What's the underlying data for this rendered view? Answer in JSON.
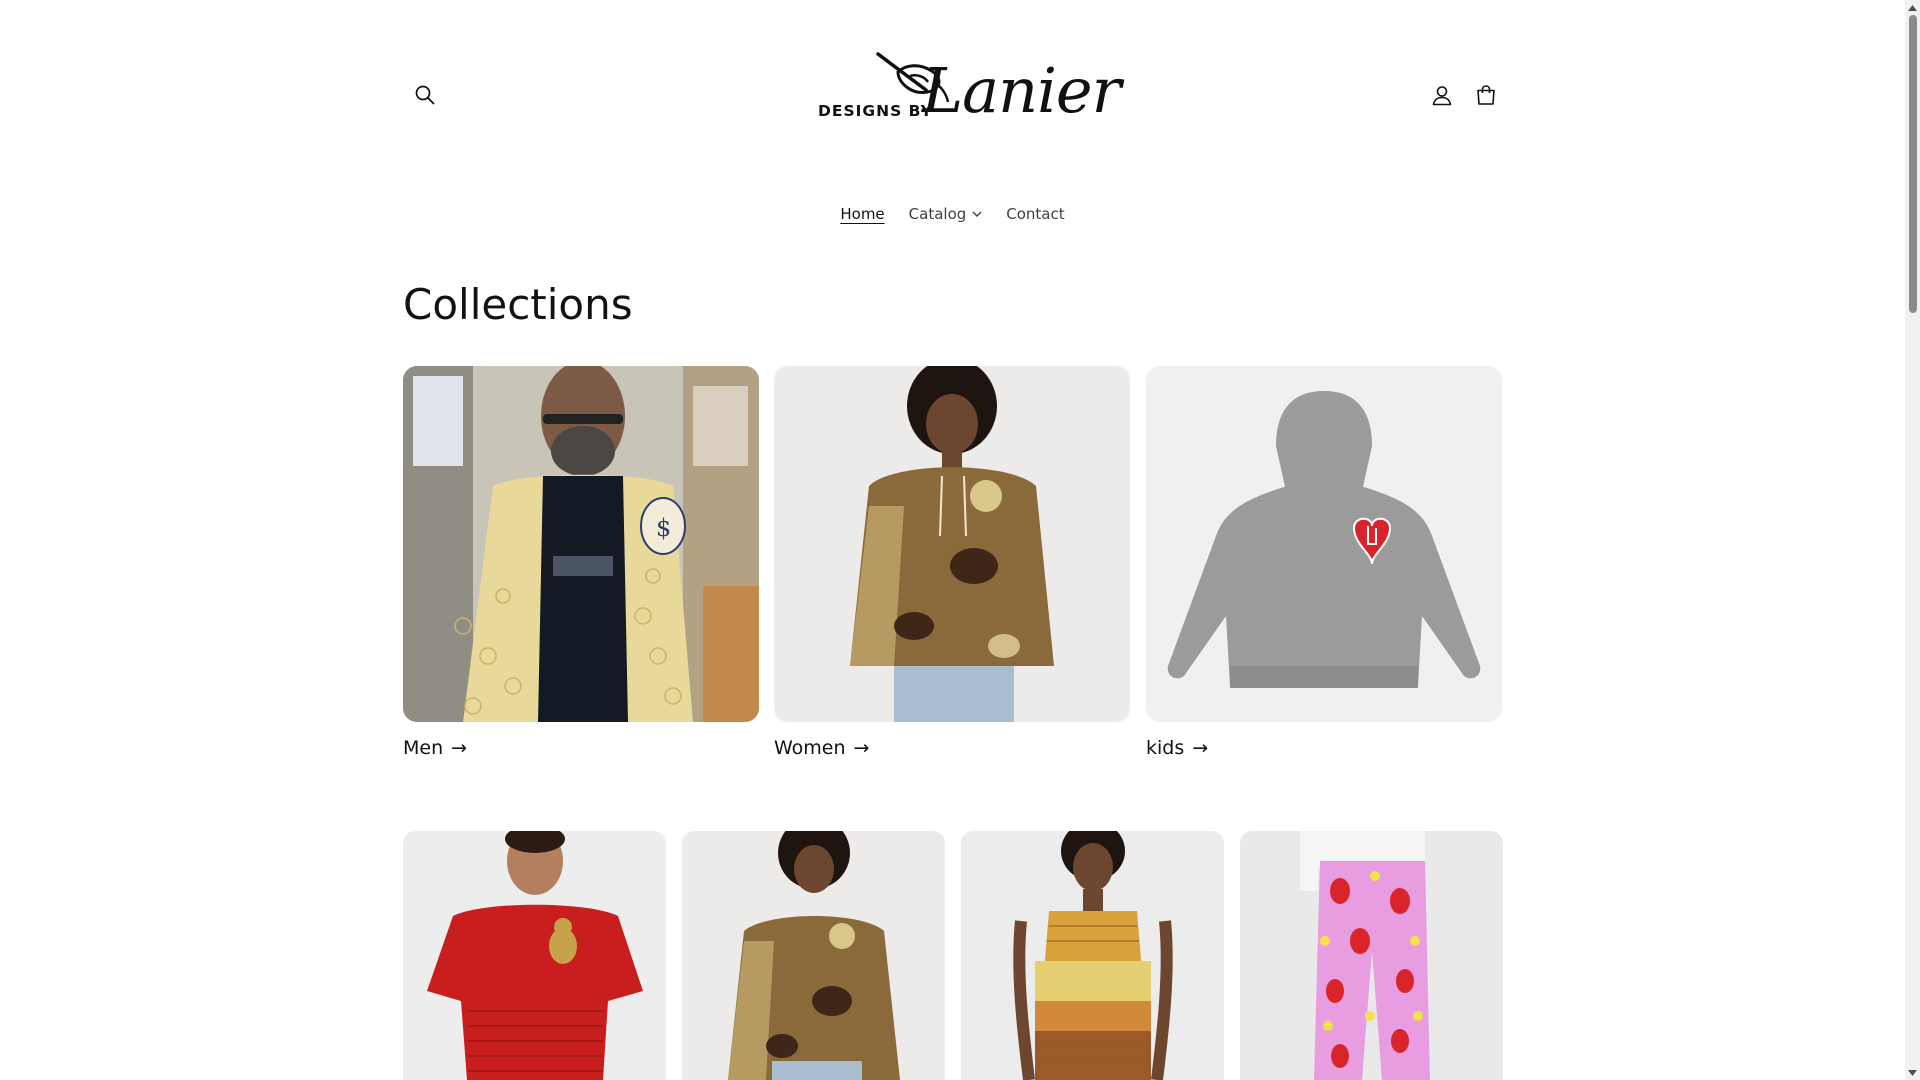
{
  "header": {
    "logo": {
      "prefix": "DESIGNS BY",
      "script": "Lanier"
    },
    "search_icon": "search-icon",
    "account_icon": "user-icon",
    "cart_icon": "cart-icon"
  },
  "nav": {
    "items": [
      {
        "label": "Home",
        "active": true
      },
      {
        "label": "Catalog",
        "has_dropdown": true
      },
      {
        "label": "Contact"
      }
    ]
  },
  "main": {
    "title": "Collections",
    "collections": [
      {
        "label": "Men",
        "arrow": "→"
      },
      {
        "label": "Women",
        "arrow": "→"
      },
      {
        "label": "kids",
        "arrow": "→"
      }
    ],
    "products": [
      {
        "description": "red t-shirt with teddy bear"
      },
      {
        "description": "camouflage hoodie"
      },
      {
        "description": "gold ombre dress"
      },
      {
        "description": "pink strawberry joggers"
      }
    ]
  },
  "colors": {
    "text": "#121212",
    "muted": "#3f3f3f",
    "card_bg": "#f3f3f3"
  }
}
